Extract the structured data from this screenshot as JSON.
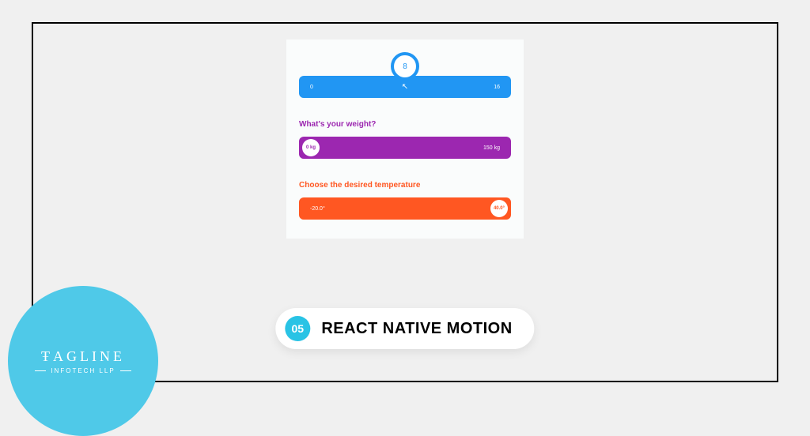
{
  "sliders": {
    "first": {
      "indicator_value": "8",
      "min_label": "0",
      "max_label": "16"
    },
    "weight": {
      "question": "What's your weight?",
      "thumb_label": "0 kg",
      "max_label": "150 kg"
    },
    "temperature": {
      "question": "Choose the desired temperature",
      "min_label": "-20.0°",
      "thumb_label": "40.0°"
    }
  },
  "title_pill": {
    "badge": "05",
    "title": "REACT NATIVE MOTION"
  },
  "logo": {
    "main": "ŦAGLINE",
    "sub": "INFOTECH LLP"
  }
}
